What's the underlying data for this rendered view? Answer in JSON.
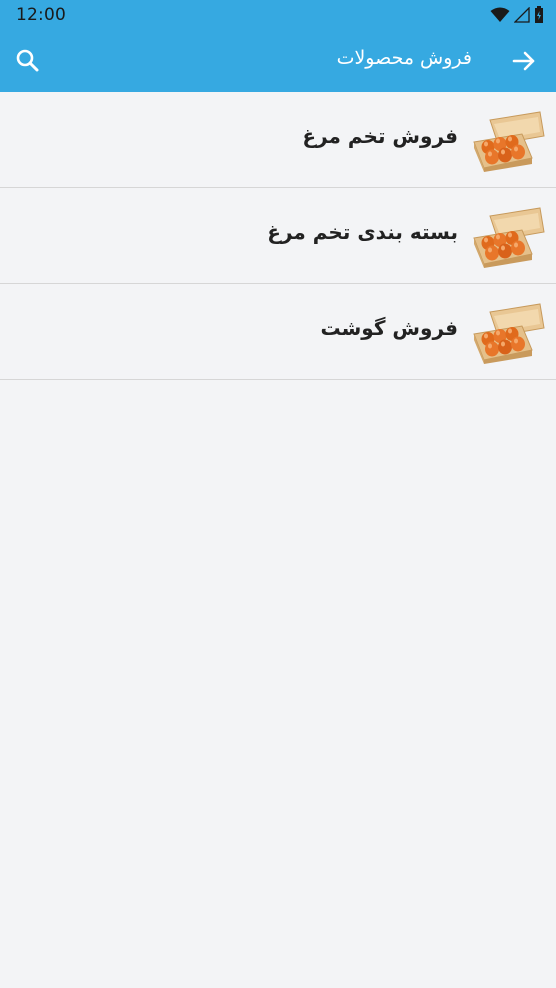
{
  "status_bar": {
    "time": "12:00"
  },
  "app_bar": {
    "title": "فروش محصولات",
    "back_icon": "arrow-right-icon",
    "search_icon": "search-icon"
  },
  "products": [
    {
      "label": "فروش تخم مرغ",
      "image": "egg-carton-image"
    },
    {
      "label": "بسته بندی تخم مرغ",
      "image": "egg-carton-image"
    },
    {
      "label": "فروش گوشت",
      "image": "egg-carton-image"
    }
  ],
  "colors": {
    "primary": "#36a9e1",
    "background": "#f3f4f6",
    "divider": "#d6d6d6",
    "text": "#222222"
  }
}
